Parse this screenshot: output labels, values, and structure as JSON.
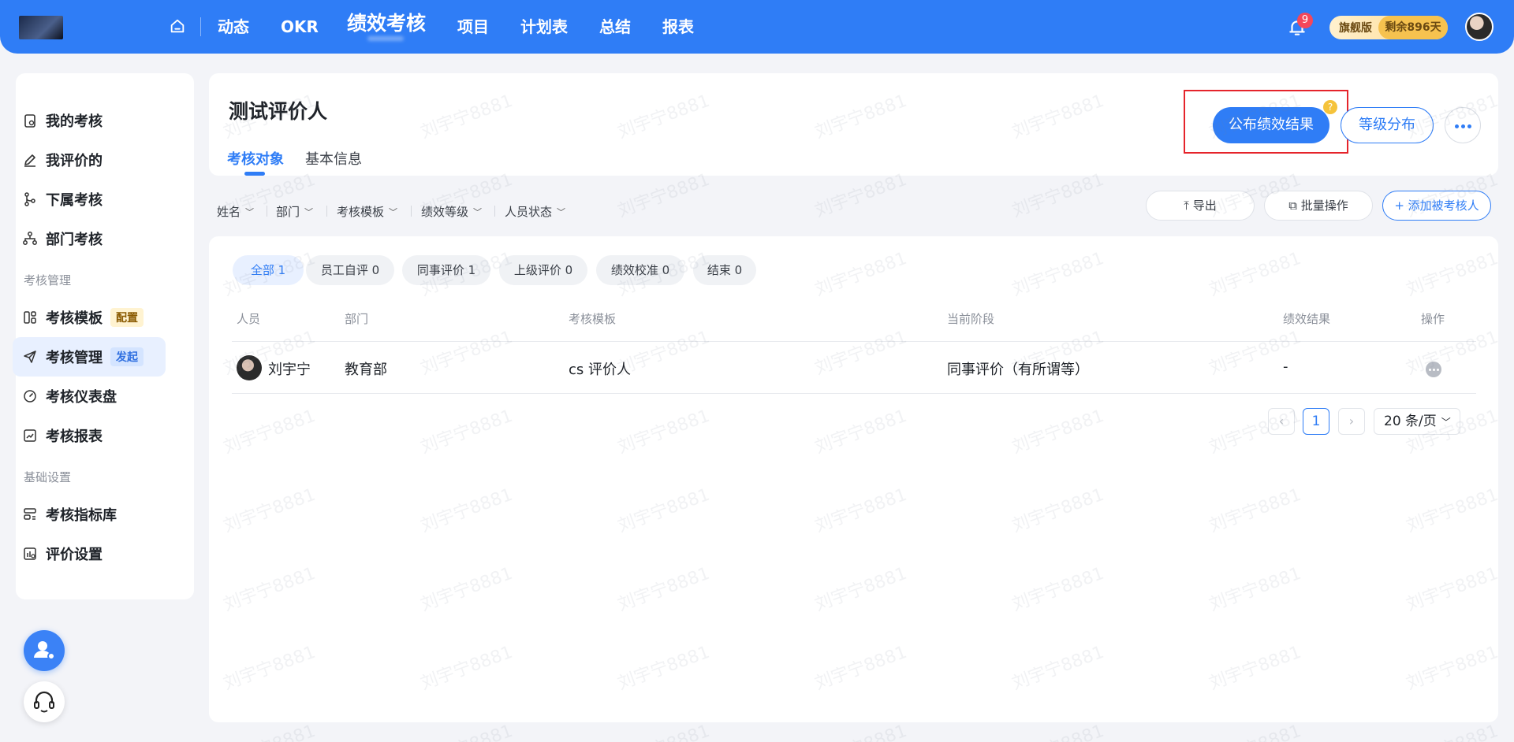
{
  "topnav": {
    "items": [
      "动态",
      "OKR",
      "绩效考核",
      "项目",
      "计划表",
      "总结",
      "报表"
    ],
    "active_index": 2,
    "notification_count": "9",
    "plan_name": "旗舰版",
    "plan_remaining": "剩余896天"
  },
  "sidebar": {
    "items": [
      {
        "label": "我的考核",
        "icon": "clipboard-icon"
      },
      {
        "label": "我评价的",
        "icon": "edit-icon"
      },
      {
        "label": "下属考核",
        "icon": "branch-icon"
      },
      {
        "label": "部门考核",
        "icon": "org-icon"
      },
      {
        "label": "考核模板",
        "icon": "template-icon",
        "tag": "配置"
      },
      {
        "label": "考核管理",
        "icon": "send-icon",
        "tag": "发起",
        "active": true
      },
      {
        "label": "考核仪表盘",
        "icon": "gauge-icon"
      },
      {
        "label": "考核报表",
        "icon": "chart-icon"
      },
      {
        "label": "考核指标库",
        "icon": "list-icon"
      },
      {
        "label": "评价设置",
        "icon": "settings-icon"
      }
    ],
    "sections": [
      "考核管理",
      "基础设置"
    ]
  },
  "header": {
    "title": "测试评价人",
    "tabs": [
      "考核对象",
      "基本信息"
    ],
    "active_tab": 0,
    "publish_button": "公布绩效结果",
    "help_mark": "?",
    "grade_button": "等级分布"
  },
  "filters": [
    "姓名",
    "部门",
    "考核模板",
    "绩效等级",
    "人员状态"
  ],
  "toolbar": {
    "export": "导出",
    "batch": "批量操作",
    "add": "添加被考核人"
  },
  "stage_chips": [
    "全部 1",
    "员工自评 0",
    "同事评价 1",
    "上级评价 0",
    "绩效校准 0",
    "结束 0"
  ],
  "table": {
    "headers": [
      "人员",
      "部门",
      "考核模板",
      "当前阶段",
      "绩效结果",
      "操作"
    ],
    "rows": [
      {
        "person": "刘宇宁",
        "department": "教育部",
        "template": "cs 评价人",
        "stage": "同事评价（有所谓等）",
        "result": "-"
      }
    ]
  },
  "pagination": {
    "current_page": "1",
    "page_size": "20 条/页"
  },
  "watermark": "刘宇宁8881",
  "colors": {
    "primary": "#2f7df6",
    "highlight_frame": "#e5242b"
  }
}
